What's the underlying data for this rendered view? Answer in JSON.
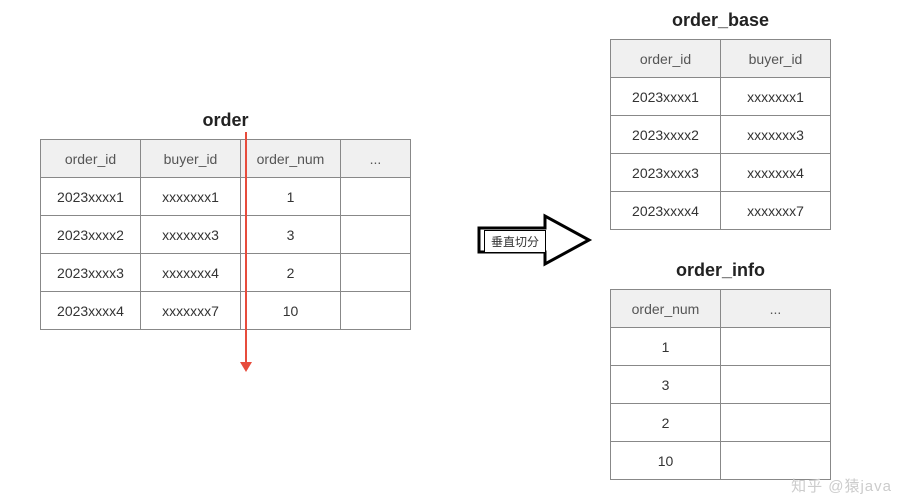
{
  "main_table": {
    "title": "order",
    "headers": [
      "order_id",
      "buyer_id",
      "order_num",
      "..."
    ],
    "rows": [
      [
        "2023xxxx1",
        "xxxxxxx1",
        "1",
        ""
      ],
      [
        "2023xxxx2",
        "xxxxxxx3",
        "3",
        ""
      ],
      [
        "2023xxxx3",
        "xxxxxxx4",
        "2",
        ""
      ],
      [
        "2023xxxx4",
        "xxxxxxx7",
        "10",
        ""
      ]
    ]
  },
  "base_table": {
    "title": "order_base",
    "headers": [
      "order_id",
      "buyer_id"
    ],
    "rows": [
      [
        "2023xxxx1",
        "xxxxxxx1"
      ],
      [
        "2023xxxx2",
        "xxxxxxx3"
      ],
      [
        "2023xxxx3",
        "xxxxxxx4"
      ],
      [
        "2023xxxx4",
        "xxxxxxx7"
      ]
    ]
  },
  "info_table": {
    "title": "order_info",
    "headers": [
      "order_num",
      "..."
    ],
    "rows": [
      [
        "1",
        ""
      ],
      [
        "3",
        ""
      ],
      [
        "2",
        ""
      ],
      [
        "10",
        ""
      ]
    ]
  },
  "arrow_label": "垂直切分",
  "watermark": "知乎 @猿java"
}
